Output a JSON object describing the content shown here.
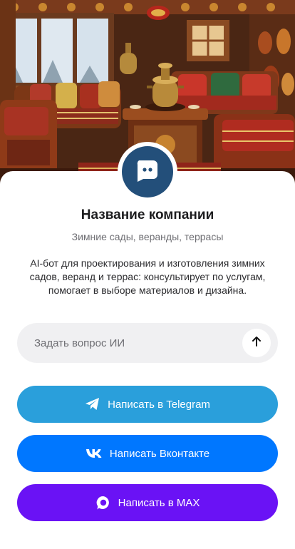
{
  "company": {
    "name": "Название компании",
    "tagline": "Зимние сады, веранды, террасы",
    "description": "AI-бот для проектирования и изготовления зимних садов, веранд и террас: консультирует по услугам, помогает в выборе материалов и дизайна.",
    "avatar_icon": "chat-bubble-icon",
    "avatar_color": "#234f7a"
  },
  "ask": {
    "placeholder": "Задать вопрос ИИ",
    "send_icon": "arrow-up-icon"
  },
  "buttons": {
    "telegram": {
      "label": "Написать в Telegram",
      "icon": "telegram-icon",
      "color": "#2a9fdb"
    },
    "vk": {
      "label": "Написать Вконтакте",
      "icon": "vk-icon",
      "color": "#0077ff"
    },
    "max": {
      "label": "Написать в MAX",
      "icon": "max-icon",
      "color": "#6a12f5"
    }
  }
}
